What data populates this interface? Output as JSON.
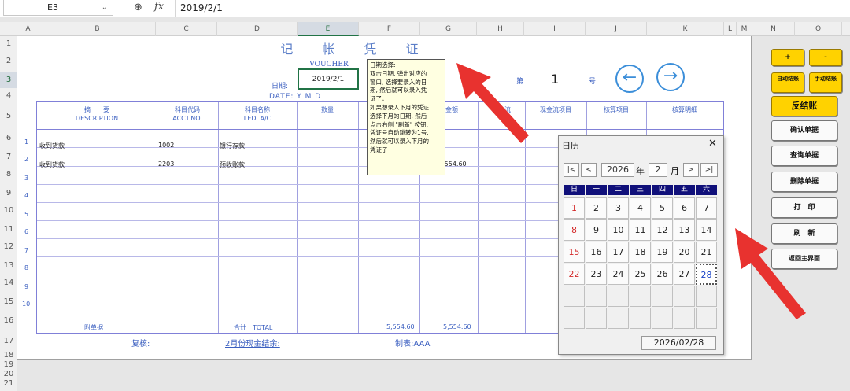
{
  "formula_bar": {
    "name_box": "E3",
    "formula": "2019/2/1"
  },
  "columns": [
    "A",
    "B",
    "C",
    "D",
    "E",
    "F",
    "G",
    "H",
    "I",
    "J",
    "K",
    "L",
    "M",
    "N",
    "O"
  ],
  "rows": [
    "1",
    "2",
    "3",
    "4",
    "5",
    "6",
    "7",
    "8",
    "9",
    "10",
    "11",
    "12",
    "13",
    "14",
    "15",
    "16",
    "17",
    "18",
    "19",
    "20",
    "21"
  ],
  "voucher": {
    "title": "记 帐 凭 证",
    "voucher_label": "VOUCHER",
    "date_label": "日期:",
    "date_value": "2019/2/1",
    "date_en": "DATE:  Y   M   D",
    "no_label": "第",
    "no_value": "1",
    "no_suffix": "号",
    "headers": [
      {
        "cn": "摘　　要",
        "en": "DESCRIPTION"
      },
      {
        "cn": "科目代码",
        "en": "ACCT.NO."
      },
      {
        "cn": "科目名称",
        "en": "LED. A/C"
      },
      {
        "cn": "数量",
        "en": ""
      },
      {
        "cn": "",
        "en": ""
      },
      {
        "cn": "方金额",
        "en": ""
      },
      {
        "cn": "现金流",
        "en": ""
      },
      {
        "cn": "现金流项目",
        "en": ""
      },
      {
        "cn": "核算项目",
        "en": ""
      },
      {
        "cn": "核算明细",
        "en": ""
      }
    ],
    "line_numbers": [
      "1",
      "2",
      "3",
      "4",
      "5",
      "6",
      "7",
      "8",
      "9",
      "10"
    ],
    "entries": [
      {
        "desc": "收到货款",
        "code": "1002",
        "name": "银行存款",
        "amount": ""
      },
      {
        "desc": "收到货款",
        "code": "2203",
        "name": "预收账款",
        "amount": "5,554.60"
      }
    ],
    "attach_label": "附单据",
    "total_label": "合计　TOTAL",
    "total_debit": "5,554.60",
    "total_credit": "5,554.60",
    "review_label": "复核:",
    "balance_link": "2月份现金结余:",
    "maker_label": "制表:AAA"
  },
  "tooltip": {
    "lines": [
      "日期选择:",
      "双击日期, 弹出对应的",
      "窗口, 选择要录入的日",
      "期, 然后就可以录入凭",
      "证了。",
      "如果想录入下月的凭证",
      "选择下月的日期, 然后",
      "点击右侧 \"刷新\" 按钮,",
      "凭证号自动跳转为1号,",
      "然后就可以录入下月的",
      "凭证了"
    ]
  },
  "sidebar": {
    "plus": "+",
    "minus": "-",
    "auto_close": "自动结账",
    "manual_close": "手动结账",
    "reverse_close": "反结账",
    "confirm": "确认单据",
    "query": "查询单据",
    "delete": "删除单据",
    "print": "打　印",
    "refresh": "刷　新",
    "back": "返回主界面"
  },
  "calendar": {
    "title": "日历",
    "year": "2026",
    "year_suffix": "年",
    "month": "2",
    "month_suffix": "月",
    "weekdays": [
      "日",
      "一",
      "二",
      "三",
      "四",
      "五",
      "六"
    ],
    "days": [
      "1",
      "2",
      "3",
      "4",
      "5",
      "6",
      "7",
      "8",
      "9",
      "10",
      "11",
      "12",
      "13",
      "14",
      "15",
      "16",
      "17",
      "18",
      "19",
      "20",
      "21",
      "22",
      "23",
      "24",
      "25",
      "26",
      "27",
      "28"
    ],
    "selected": "28",
    "date_display": "2026/02/28"
  },
  "colors": {
    "accent_red": "#e8322f",
    "button_yellow": "#ffd200",
    "calendar_header": "#10107a",
    "voucher_blue": "#3b5fc0"
  }
}
